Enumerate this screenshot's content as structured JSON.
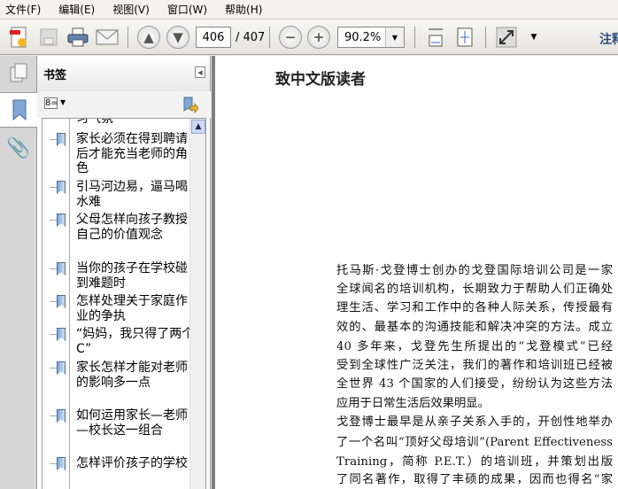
{
  "menu": [
    "文件(F)",
    "编辑(E)",
    "视图(V)",
    "窗口(W)",
    "帮助(H)"
  ],
  "toolbar": {
    "current_page": "406",
    "total_pages": "/ 407",
    "zoom": "90.2%",
    "comment_label": "注释"
  },
  "panel": {
    "title": "书签"
  },
  "bookmarks": [
    "习气氛",
    "家长必须在得到聘请后才能充当老师的角色",
    "引马河边易，逼马喝水难",
    "父母怎样向孩子教授自己的价值观念",
    "当你的孩子在学校碰到难题时",
    "怎样处理关于家庭作业的争执",
    "“妈妈，我只得了两个C”",
    "家长怎样才能对老师的影响多一点",
    "如何运用家长—老师—校长这一组合",
    "怎样评价孩子的学校"
  ],
  "document": {
    "title": "致中文版读者",
    "lines": [
      "托马斯·戈登博士创办的戈登国际培训公司是一家",
      "全球闻名的培训机构，长期致力于帮助人们正确处",
      "理生活、学习和工作中的各种人际关系，传授最有",
      "效的、最基本的沟通技能和解决冲突的方法。成立",
      "40 多年来，戈登先生所提出的“戈登模式”已经",
      "受到全球性广泛关注，我们的著作和培训班已经被",
      "全世界 43 个国家的人们接受，纷纷认为这些方法",
      "应用于日常生活后效果明显。",
      "戈登博士最早是从亲子关系入手的，开创性地举办",
      "了一个名叫“顶好父母培训”(Parent Effectiveness",
      "Training，简称 P.E.T.）的培训班，并策划出版",
      "了同名著作，取得了丰硕的成果，因而也得名“家"
    ]
  }
}
